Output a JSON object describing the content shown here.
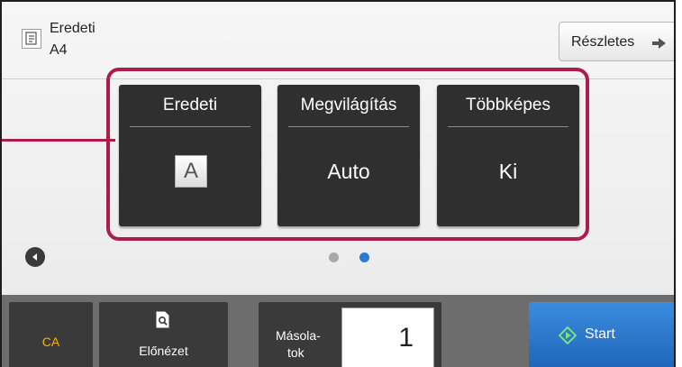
{
  "header": {
    "original_label": "Eredeti",
    "original_size": "A4",
    "details_button": "Részletes",
    "original_icon": "document-icon",
    "details_arrow_icon": "arrow-right-icon"
  },
  "tiles": [
    {
      "label": "Eredeti",
      "value": "A"
    },
    {
      "label": "Megvilágítás",
      "value": "Auto"
    },
    {
      "label": "Többképes",
      "value": "Ki"
    }
  ],
  "pager": {
    "back_icon": "chevron-left-icon",
    "current_page": 2,
    "total_pages": 2
  },
  "bottom": {
    "ca_label": "CA",
    "preview_label": "Előnézet",
    "preview_icon": "preview-magnifier-icon",
    "copies_label_line1": "Másola-",
    "copies_label_line2": "tok",
    "copies_value": "1",
    "start_label": "Start",
    "start_icon": "start-diamond-icon"
  },
  "colors": {
    "highlight": "#b01c4a",
    "tile_bg": "#2f2f2f",
    "start_blue": "#2a7ad6",
    "ca_yellow": "#f2b200",
    "active_dot": "#2a7ad6"
  }
}
